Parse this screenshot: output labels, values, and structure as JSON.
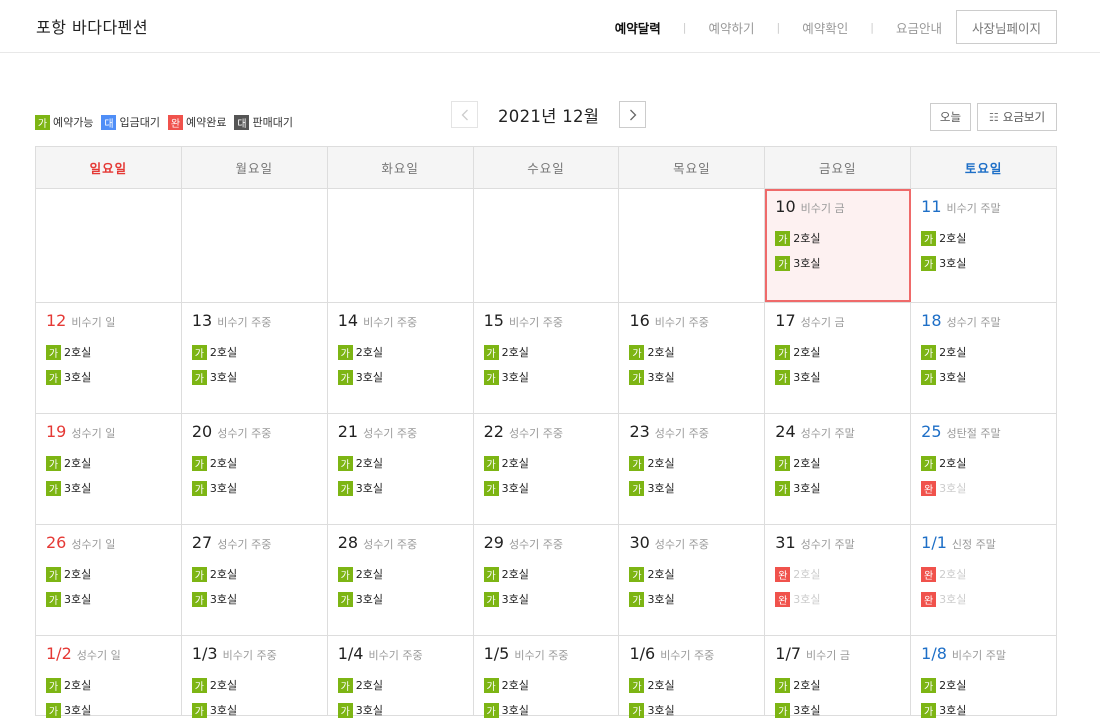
{
  "header": {
    "brand": "포항 바다다펜션",
    "nav": [
      "예약달력",
      "예약하기",
      "예약확인",
      "요금안내"
    ],
    "owner_button": "사장님페이지"
  },
  "legend": [
    {
      "badge": "가",
      "label": "예약가능"
    },
    {
      "badge": "대",
      "label": "입금대기"
    },
    {
      "badge": "완",
      "label": "예약완료"
    },
    {
      "badge": "대",
      "label": "판매대기"
    }
  ],
  "calendar_nav": {
    "prev_icon": "chevron-left-icon",
    "next_icon": "chevron-right-icon",
    "title": "2021년 12월",
    "today_button": "오늘",
    "price_button": "요금보기",
    "price_button_icon": "list-icon"
  },
  "weekdays": [
    "일요일",
    "월요일",
    "화요일",
    "수요일",
    "목요일",
    "금요일",
    "토요일"
  ],
  "colors": {
    "available": "#7db514",
    "waiting": "#4f8ef7",
    "booked": "#f0524c",
    "hold": "#555555",
    "sunday": "#e53935",
    "saturday": "#1e6fc7"
  },
  "weeks": [
    [
      null,
      null,
      null,
      null,
      null,
      {
        "day": "10",
        "tag": "비수기 금",
        "today": true,
        "rooms": [
          {
            "status": "가",
            "name": "2호실"
          },
          {
            "status": "가",
            "name": "3호실"
          }
        ]
      },
      {
        "day": "11",
        "tag": "비수기 주말",
        "rooms": [
          {
            "status": "가",
            "name": "2호실"
          },
          {
            "status": "가",
            "name": "3호실"
          }
        ]
      }
    ],
    [
      {
        "day": "12",
        "tag": "비수기 일",
        "rooms": [
          {
            "status": "가",
            "name": "2호실"
          },
          {
            "status": "가",
            "name": "3호실"
          }
        ]
      },
      {
        "day": "13",
        "tag": "비수기 주중",
        "rooms": [
          {
            "status": "가",
            "name": "2호실"
          },
          {
            "status": "가",
            "name": "3호실"
          }
        ]
      },
      {
        "day": "14",
        "tag": "비수기 주중",
        "rooms": [
          {
            "status": "가",
            "name": "2호실"
          },
          {
            "status": "가",
            "name": "3호실"
          }
        ]
      },
      {
        "day": "15",
        "tag": "비수기 주중",
        "rooms": [
          {
            "status": "가",
            "name": "2호실"
          },
          {
            "status": "가",
            "name": "3호실"
          }
        ]
      },
      {
        "day": "16",
        "tag": "비수기 주중",
        "rooms": [
          {
            "status": "가",
            "name": "2호실"
          },
          {
            "status": "가",
            "name": "3호실"
          }
        ]
      },
      {
        "day": "17",
        "tag": "성수기 금",
        "rooms": [
          {
            "status": "가",
            "name": "2호실"
          },
          {
            "status": "가",
            "name": "3호실"
          }
        ]
      },
      {
        "day": "18",
        "tag": "성수기 주말",
        "rooms": [
          {
            "status": "가",
            "name": "2호실"
          },
          {
            "status": "가",
            "name": "3호실"
          }
        ]
      }
    ],
    [
      {
        "day": "19",
        "tag": "성수기 일",
        "rooms": [
          {
            "status": "가",
            "name": "2호실"
          },
          {
            "status": "가",
            "name": "3호실"
          }
        ]
      },
      {
        "day": "20",
        "tag": "성수기 주중",
        "rooms": [
          {
            "status": "가",
            "name": "2호실"
          },
          {
            "status": "가",
            "name": "3호실"
          }
        ]
      },
      {
        "day": "21",
        "tag": "성수기 주중",
        "rooms": [
          {
            "status": "가",
            "name": "2호실"
          },
          {
            "status": "가",
            "name": "3호실"
          }
        ]
      },
      {
        "day": "22",
        "tag": "성수기 주중",
        "rooms": [
          {
            "status": "가",
            "name": "2호실"
          },
          {
            "status": "가",
            "name": "3호실"
          }
        ]
      },
      {
        "day": "23",
        "tag": "성수기 주중",
        "rooms": [
          {
            "status": "가",
            "name": "2호실"
          },
          {
            "status": "가",
            "name": "3호실"
          }
        ]
      },
      {
        "day": "24",
        "tag": "성수기 주말",
        "rooms": [
          {
            "status": "가",
            "name": "2호실"
          },
          {
            "status": "가",
            "name": "3호실"
          }
        ]
      },
      {
        "day": "25",
        "tag": "성탄절 주말",
        "rooms": [
          {
            "status": "가",
            "name": "2호실"
          },
          {
            "status": "완",
            "name": "3호실"
          }
        ]
      }
    ],
    [
      {
        "day": "26",
        "tag": "성수기 일",
        "rooms": [
          {
            "status": "가",
            "name": "2호실"
          },
          {
            "status": "가",
            "name": "3호실"
          }
        ]
      },
      {
        "day": "27",
        "tag": "성수기 주중",
        "rooms": [
          {
            "status": "가",
            "name": "2호실"
          },
          {
            "status": "가",
            "name": "3호실"
          }
        ]
      },
      {
        "day": "28",
        "tag": "성수기 주중",
        "rooms": [
          {
            "status": "가",
            "name": "2호실"
          },
          {
            "status": "가",
            "name": "3호실"
          }
        ]
      },
      {
        "day": "29",
        "tag": "성수기 주중",
        "rooms": [
          {
            "status": "가",
            "name": "2호실"
          },
          {
            "status": "가",
            "name": "3호실"
          }
        ]
      },
      {
        "day": "30",
        "tag": "성수기 주중",
        "rooms": [
          {
            "status": "가",
            "name": "2호실"
          },
          {
            "status": "가",
            "name": "3호실"
          }
        ]
      },
      {
        "day": "31",
        "tag": "성수기 주말",
        "rooms": [
          {
            "status": "완",
            "name": "2호실"
          },
          {
            "status": "완",
            "name": "3호실"
          }
        ]
      },
      {
        "day": "1/1",
        "tag": "신정 주말",
        "rooms": [
          {
            "status": "완",
            "name": "2호실"
          },
          {
            "status": "완",
            "name": "3호실"
          }
        ]
      }
    ],
    [
      {
        "day": "1/2",
        "tag": "성수기 일",
        "rooms": [
          {
            "status": "가",
            "name": "2호실"
          },
          {
            "status": "가",
            "name": "3호실"
          }
        ]
      },
      {
        "day": "1/3",
        "tag": "비수기 주중",
        "rooms": [
          {
            "status": "가",
            "name": "2호실"
          },
          {
            "status": "가",
            "name": "3호실"
          }
        ]
      },
      {
        "day": "1/4",
        "tag": "비수기 주중",
        "rooms": [
          {
            "status": "가",
            "name": "2호실"
          },
          {
            "status": "가",
            "name": "3호실"
          }
        ]
      },
      {
        "day": "1/5",
        "tag": "비수기 주중",
        "rooms": [
          {
            "status": "가",
            "name": "2호실"
          },
          {
            "status": "가",
            "name": "3호실"
          }
        ]
      },
      {
        "day": "1/6",
        "tag": "비수기 주중",
        "rooms": [
          {
            "status": "가",
            "name": "2호실"
          },
          {
            "status": "가",
            "name": "3호실"
          }
        ]
      },
      {
        "day": "1/7",
        "tag": "비수기 금",
        "rooms": [
          {
            "status": "가",
            "name": "2호실"
          },
          {
            "status": "가",
            "name": "3호실"
          }
        ]
      },
      {
        "day": "1/8",
        "tag": "비수기 주말",
        "rooms": [
          {
            "status": "가",
            "name": "2호실"
          },
          {
            "status": "가",
            "name": "3호실"
          }
        ]
      }
    ]
  ]
}
